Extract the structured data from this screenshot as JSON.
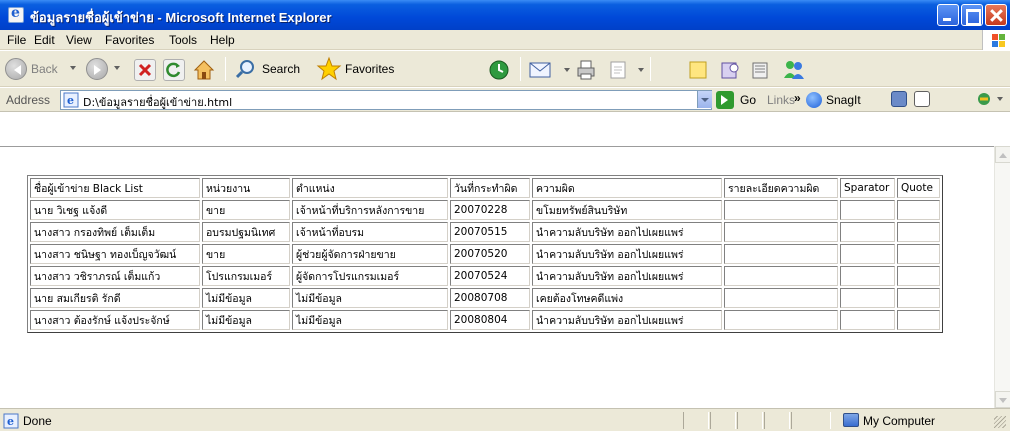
{
  "window": {
    "title": "ข้อมูลรายชื่อผู้เข้าข่าย - Microsoft Internet Explorer"
  },
  "menu": [
    "File",
    "Edit",
    "View",
    "Favorites",
    "Tools",
    "Help"
  ],
  "toolbar": {
    "back": "Back",
    "search": "Search",
    "favorites": "Favorites"
  },
  "address": {
    "label": "Address",
    "value": "D:\\ข้อมูลรายชื่อผู้เข้าข่าย.html",
    "go": "Go",
    "links": "Links",
    "chevron": "»",
    "snagit": "SnagIt"
  },
  "table": {
    "headers": [
      "ชื่อผู้เข้าข่าย Black List",
      "หน่วยงาน",
      "ตำแหน่ง",
      "วันที่กระทำผิด",
      "ความผิด",
      "รายละเอียดความผิด",
      "Sparator",
      "Quote"
    ],
    "rows": [
      [
        "นาย วิเชฐ แจ้งดี",
        "ขาย",
        "เจ้าหน้าที่บริการหลังการขาย",
        "20070228",
        "ขโมยทรัพย์สินบริษัท",
        "",
        "",
        ""
      ],
      [
        "นางสาว กรองทิพย์ เต็มเต็ม",
        "อบรมปฐมนิเทศ",
        "เจ้าหน้าที่อบรม",
        "20070515",
        "นำความลับบริษัท ออกไปเผยแพร่",
        "",
        "",
        ""
      ],
      [
        "นางสาว ชนิษฐา ทองเบ็ญจวัฒน์",
        "ขาย",
        "ผู้ช่วยผู้จัดการฝ่ายขาย",
        "20070520",
        "นำความลับบริษัท ออกไปเผยแพร่",
        "",
        "",
        ""
      ],
      [
        "นางสาว วชิราภรณ์ เต็มแก้ว",
        "โปรแกรมเมอร์",
        "ผู้จัดการโปรแกรมเมอร์",
        "20070524",
        "นำความลับบริษัท ออกไปเผยแพร่",
        "",
        "",
        ""
      ],
      [
        "นาย สมเกียรติ รักดี",
        "ไม่มีข้อมูล",
        "ไม่มีข้อมูล",
        "20080708",
        "เคยต้องโทษคดีแพ่ง",
        "",
        "",
        ""
      ],
      [
        "นางสาว ต้องรักษ์ แจ้งประจักษ์",
        "ไม่มีข้อมูล",
        "ไม่มีข้อมูล",
        "20080804",
        "นำความลับบริษัท ออกไปเผยแพร่",
        "",
        "",
        ""
      ]
    ]
  },
  "status": {
    "text": "Done",
    "zone": "My Computer"
  }
}
